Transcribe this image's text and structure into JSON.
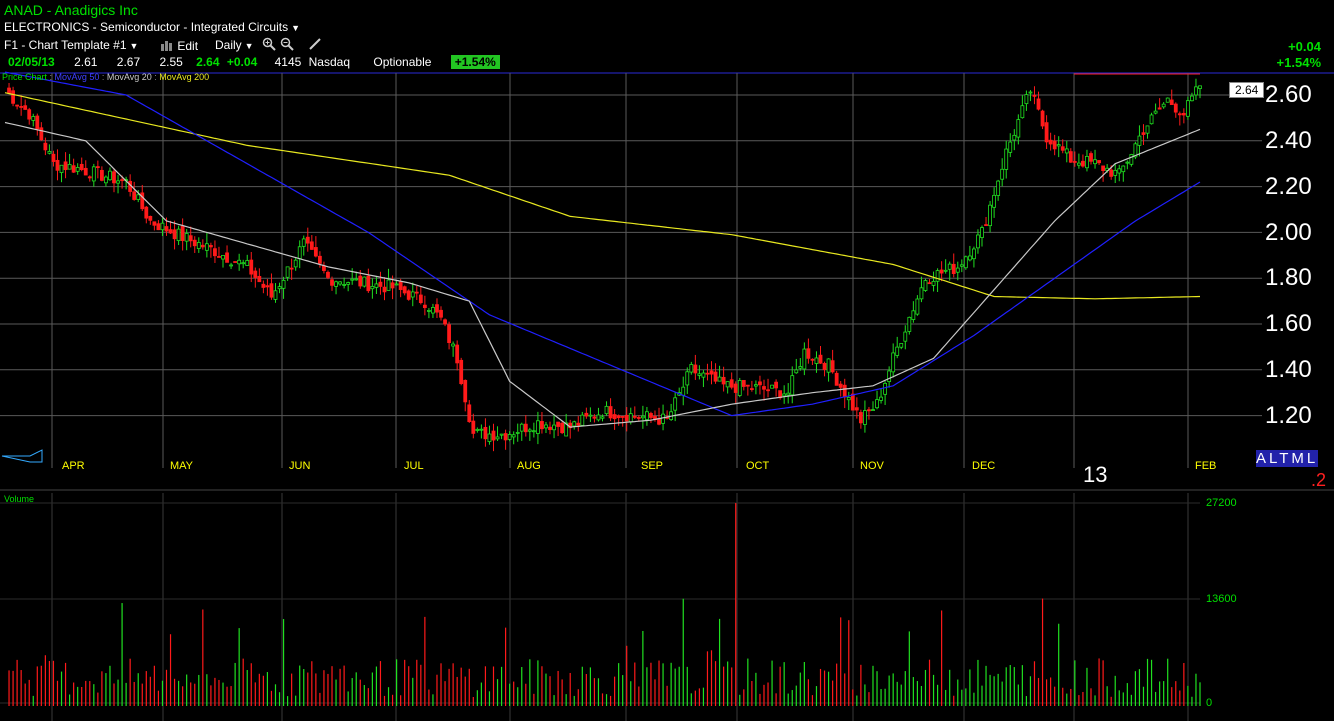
{
  "header": {
    "title": "ANAD - Anadigics Inc",
    "industry": "ELECTRONICS - Semiconductor - Integrated Circuits",
    "template": "F1 - Chart Template #1",
    "edit_label": "Edit",
    "period": "Daily",
    "date": "02/05/13",
    "open": "2.61",
    "high": "2.67",
    "low": "2.55",
    "close": "2.64",
    "change": "+0.04",
    "volume": "4145",
    "exchange": "Nasdaq",
    "optionable": "Optionable",
    "pct_change": "+1.54%",
    "right_change": "+0.04",
    "right_pct": "+1.54%"
  },
  "legend": {
    "price_chart": "Price Chart",
    "ma50": "MovAvg 50",
    "ma20": "MovAvg 20",
    "ma200": "MovAvg 200"
  },
  "price_tag": "2.64",
  "year_label": "13",
  "altml": "ALTML",
  "altml_sub": ".2",
  "volume_panel_label": "Volume",
  "colors": {
    "up": "#20e020",
    "down": "#ff1a1a",
    "ma20": "#c8c8c8",
    "ma50": "#2020ff",
    "ma200": "#e8e820",
    "grid": "#5a5a5a",
    "accent": "#00e000"
  },
  "chart_data": {
    "type": "candlestick",
    "x": [
      "APR",
      "MAY",
      "JUN",
      "JUL",
      "AUG",
      "SEP",
      "OCT",
      "NOV",
      "DEC",
      "FEB"
    ],
    "y_ticks": [
      "2.60",
      "2.40",
      "2.20",
      "2.00",
      "1.80",
      "1.60",
      "1.40",
      "1.20"
    ],
    "ylim": [
      1.1,
      2.7
    ],
    "volume_ticks": [
      "27200",
      "13600",
      "0"
    ],
    "volume_ylim": [
      0,
      27200
    ],
    "last_close": 2.64,
    "close_anchors": [
      [
        0,
        2.62
      ],
      [
        6,
        2.52
      ],
      [
        12,
        2.3
      ],
      [
        18,
        2.28
      ],
      [
        24,
        2.25
      ],
      [
        30,
        2.22
      ],
      [
        36,
        2.05
      ],
      [
        44,
        1.98
      ],
      [
        52,
        1.92
      ],
      [
        60,
        1.85
      ],
      [
        66,
        1.72
      ],
      [
        74,
        1.95
      ],
      [
        80,
        1.8
      ],
      [
        88,
        1.78
      ],
      [
        96,
        1.76
      ],
      [
        104,
        1.7
      ],
      [
        108,
        1.62
      ],
      [
        112,
        1.45
      ],
      [
        116,
        1.12
      ],
      [
        124,
        1.12
      ],
      [
        132,
        1.17
      ],
      [
        140,
        1.15
      ],
      [
        148,
        1.22
      ],
      [
        156,
        1.2
      ],
      [
        164,
        1.18
      ],
      [
        170,
        1.4
      ],
      [
        178,
        1.33
      ],
      [
        186,
        1.32
      ],
      [
        194,
        1.3
      ],
      [
        198,
        1.48
      ],
      [
        204,
        1.42
      ],
      [
        208,
        1.3
      ],
      [
        212,
        1.18
      ],
      [
        216,
        1.25
      ],
      [
        220,
        1.45
      ],
      [
        224,
        1.63
      ],
      [
        228,
        1.8
      ],
      [
        236,
        1.85
      ],
      [
        242,
        2.0
      ],
      [
        248,
        2.35
      ],
      [
        254,
        2.62
      ],
      [
        258,
        2.42
      ],
      [
        264,
        2.32
      ],
      [
        270,
        2.3
      ],
      [
        276,
        2.25
      ],
      [
        282,
        2.45
      ],
      [
        288,
        2.58
      ],
      [
        292,
        2.52
      ],
      [
        296,
        2.64
      ]
    ],
    "ma_anchors": {
      "ma200": [
        [
          0,
          2.61
        ],
        [
          60,
          2.38
        ],
        [
          110,
          2.25
        ],
        [
          140,
          2.07
        ],
        [
          180,
          1.99
        ],
        [
          220,
          1.86
        ],
        [
          245,
          1.72
        ],
        [
          270,
          1.71
        ],
        [
          296,
          1.72
        ]
      ],
      "ma50": [
        [
          0,
          2.7
        ],
        [
          30,
          2.6
        ],
        [
          60,
          2.3
        ],
        [
          90,
          2.0
        ],
        [
          120,
          1.64
        ],
        [
          150,
          1.42
        ],
        [
          180,
          1.2
        ],
        [
          200,
          1.25
        ],
        [
          220,
          1.33
        ],
        [
          240,
          1.55
        ],
        [
          260,
          1.8
        ],
        [
          280,
          2.05
        ],
        [
          296,
          2.22
        ]
      ],
      "ma20": [
        [
          0,
          2.48
        ],
        [
          20,
          2.4
        ],
        [
          40,
          2.05
        ],
        [
          60,
          1.95
        ],
        [
          80,
          1.85
        ],
        [
          100,
          1.78
        ],
        [
          115,
          1.7
        ],
        [
          125,
          1.35
        ],
        [
          140,
          1.15
        ],
        [
          160,
          1.18
        ],
        [
          180,
          1.25
        ],
        [
          200,
          1.3
        ],
        [
          215,
          1.33
        ],
        [
          230,
          1.45
        ],
        [
          245,
          1.75
        ],
        [
          260,
          2.05
        ],
        [
          275,
          2.3
        ],
        [
          296,
          2.45
        ]
      ]
    }
  }
}
